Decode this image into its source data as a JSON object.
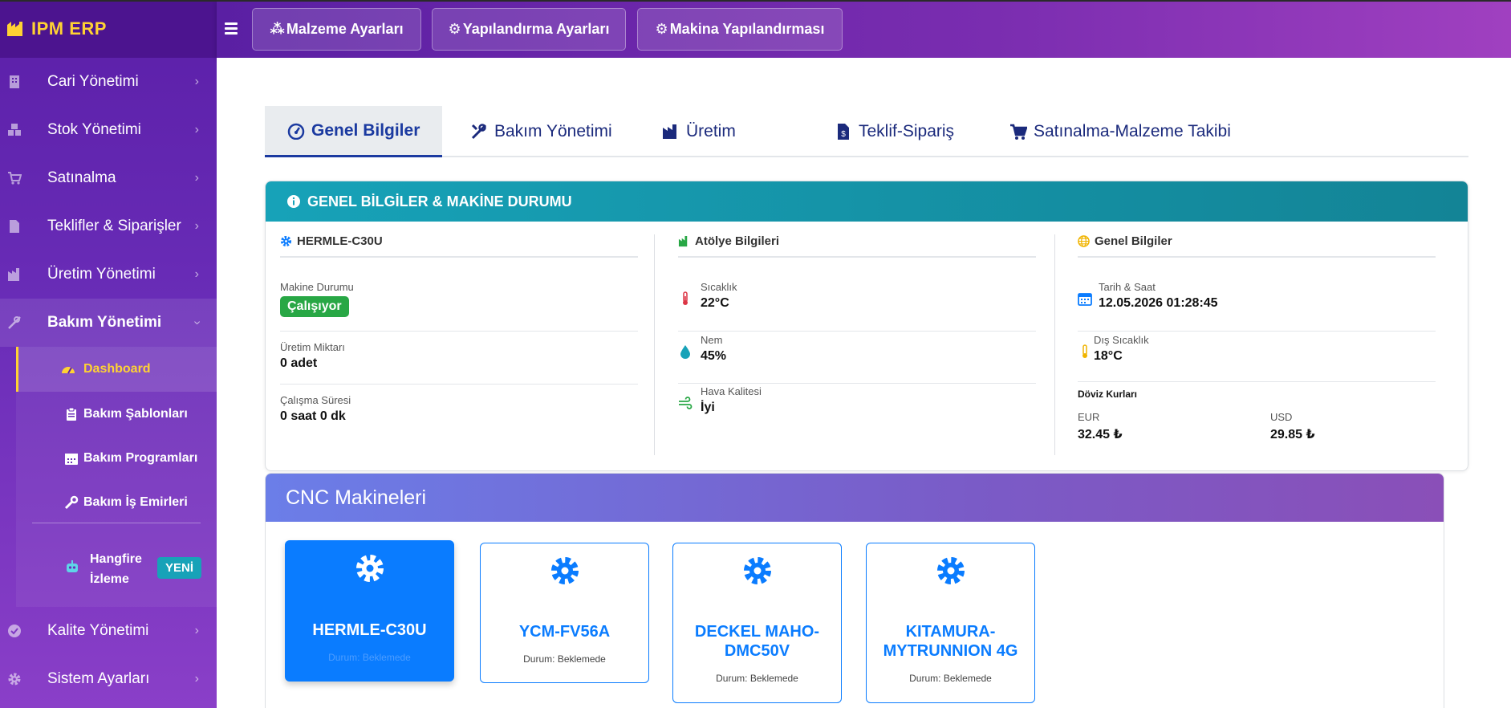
{
  "brand": {
    "name": "IPM ERP"
  },
  "sidebar": {
    "items": [
      {
        "label": "Cari Yönetimi",
        "icon": "building-icon"
      },
      {
        "label": "Stok Yönetimi",
        "icon": "boxes-icon"
      },
      {
        "label": "Satınalma",
        "icon": "cart-icon"
      },
      {
        "label": "Teklifler & Siparişler",
        "icon": "file-invoice-icon"
      },
      {
        "label": "Üretim Yönetimi",
        "icon": "industry-icon"
      },
      {
        "label": "Bakım Yönetimi",
        "icon": "tools-icon"
      }
    ],
    "bakim_sub": [
      {
        "label": "Dashboard",
        "icon": "gauge-icon"
      },
      {
        "label": "Bakım Şablonları",
        "icon": "clipboard-icon"
      },
      {
        "label": "Bakım Programları",
        "icon": "calendar-icon"
      },
      {
        "label": "Bakım İş Emirleri",
        "icon": "wrench-icon"
      }
    ],
    "hangfire": {
      "label": "Hangfire İzleme",
      "badge": "YENİ"
    },
    "bottom_items": [
      {
        "label": "Kalite Yönetimi",
        "icon": "check-circle-icon"
      },
      {
        "label": "Sistem Ayarları",
        "icon": "gear-icon"
      }
    ]
  },
  "topbar": {
    "buttons": [
      {
        "label": "Malzeme Ayarları",
        "icon": "cubes-icon"
      },
      {
        "label": "Yapılandırma Ayarları",
        "icon": "gear-icon"
      },
      {
        "label": "Makina Yapılandırması",
        "icon": "gears-icon"
      }
    ]
  },
  "tabs": [
    {
      "label": "Genel Bilgiler",
      "icon": "gauge-icon"
    },
    {
      "label": "Bakım Yönetimi",
      "icon": "tools-icon"
    },
    {
      "label": "Üretim",
      "icon": "industry-icon"
    },
    {
      "label": "Teklif-Sipariş",
      "icon": "file-invoice-dollar-icon"
    },
    {
      "label": "Satınalma-Malzeme Takibi",
      "icon": "cart-icon"
    }
  ],
  "general": {
    "title": "GENEL BİLGİLER & MAKİNE DURUMU",
    "machine": {
      "title": "HERMLE-C30U",
      "status_label": "Makine Durumu",
      "status_value": "Çalışıyor",
      "production_label": "Üretim Miktarı",
      "production_value": "0 adet",
      "runtime_label": "Çalışma Süresi",
      "runtime_value": "0 saat 0 dk"
    },
    "workshop": {
      "title": "Atölye Bilgileri",
      "temp_label": "Sıcaklık",
      "temp_value": "22°C",
      "humidity_label": "Nem",
      "humidity_value": "45%",
      "air_label": "Hava Kalitesi",
      "air_value": "İyi"
    },
    "info": {
      "title": "Genel Bilgiler",
      "datetime_label": "Tarih & Saat",
      "datetime_value": "12.05.2026 01:28:45",
      "outside_label": "Dış Sıcaklık",
      "outside_value": "18°C",
      "fx_title": "Döviz Kurları",
      "eur_label": "EUR",
      "eur_value": "32.45 ₺",
      "usd_label": "USD",
      "usd_value": "29.85 ₺"
    }
  },
  "cnc": {
    "title": "CNC Makineleri",
    "machines": [
      {
        "name": "HERMLE-C30U",
        "status": "Durum: Beklemede"
      },
      {
        "name": "YCM-FV56A",
        "status": "Durum: Beklemede"
      },
      {
        "name": "DECKEL MAHO-DMC50V",
        "status": "Durum: Beklemede"
      },
      {
        "name": "KITAMURA-MYTRUNNION 4G",
        "status": "Durum: Beklemede"
      }
    ]
  },
  "colors": {
    "accent": "#ffd233",
    "primary": "#0a7cff",
    "success": "#28a745",
    "info": "#17a2b8",
    "sidebar": "#5b1fa8"
  }
}
